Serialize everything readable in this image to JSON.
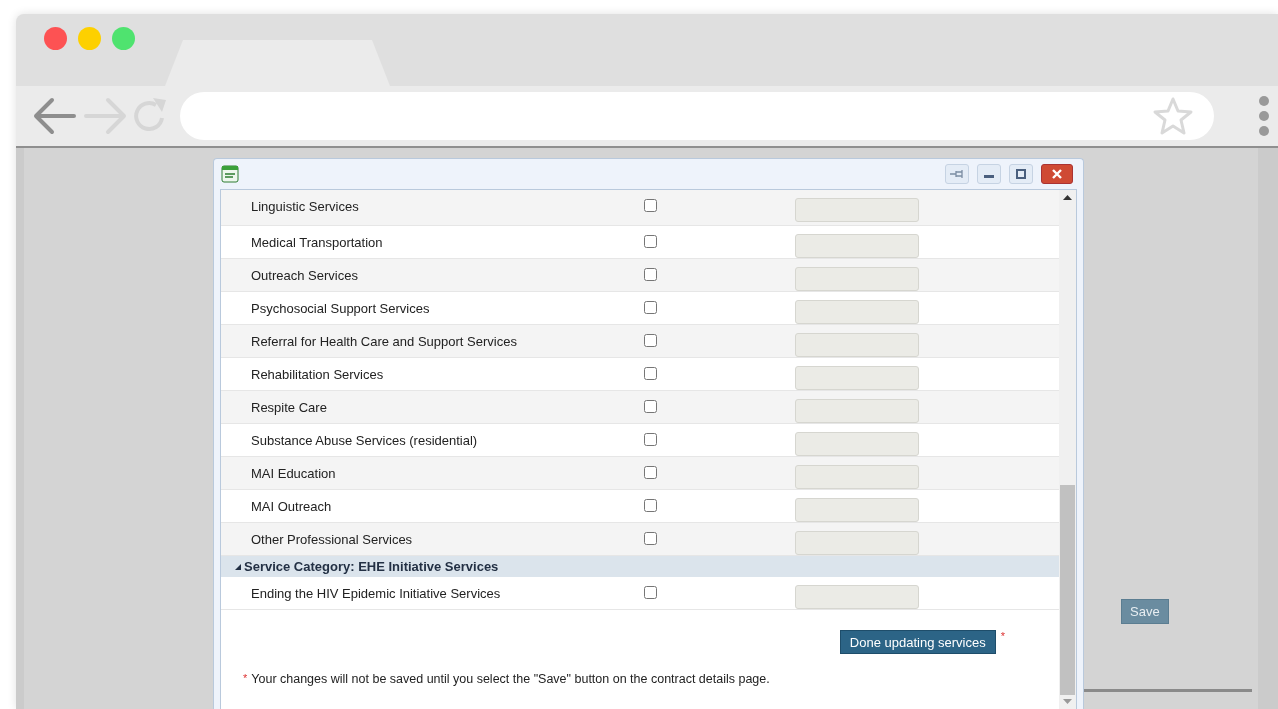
{
  "dialog": {
    "rows": [
      {
        "label": "Linguistic Services",
        "checked": false,
        "disabled": true
      },
      {
        "label": "Medical Transportation",
        "checked": false,
        "disabled": true
      },
      {
        "label": "Outreach Services",
        "checked": false,
        "disabled": true
      },
      {
        "label": "Psychosocial Support Services",
        "checked": false,
        "disabled": true
      },
      {
        "label": "Referral for Health Care and Support Services",
        "checked": false,
        "disabled": true
      },
      {
        "label": "Rehabilitation Services",
        "checked": false,
        "disabled": true
      },
      {
        "label": "Respite Care",
        "checked": false,
        "disabled": true
      },
      {
        "label": "Substance Abuse Services (residential)",
        "checked": false,
        "disabled": true
      },
      {
        "label": "MAI Education",
        "checked": false,
        "disabled": true
      },
      {
        "label": "MAI Outreach",
        "checked": false,
        "disabled": true
      },
      {
        "label": "Other Professional Services",
        "checked": false,
        "disabled": true
      }
    ],
    "categories": [
      {
        "title": "Service Category: EHE Initiative Services",
        "expanded": true,
        "rows": [
          {
            "label": "Ending the HIV Epidemic Initiative Services",
            "checked": false,
            "disabled": true
          }
        ]
      }
    ],
    "done_button": "Done updating services",
    "required_mark": "*",
    "note_mark": "*",
    "note": "Your changes will not be saved until you select the \"Save\" button on the contract details page."
  },
  "page": {
    "save_button": "Save"
  }
}
